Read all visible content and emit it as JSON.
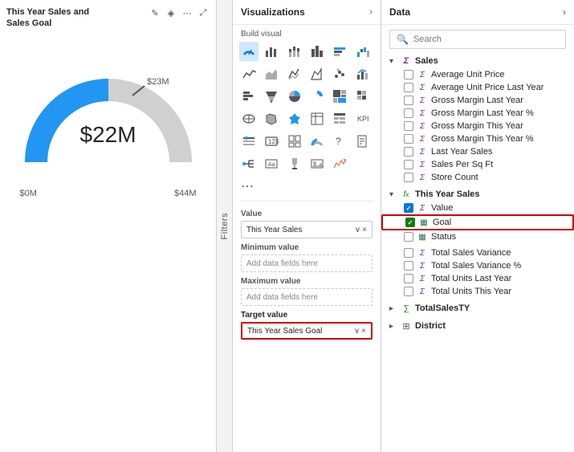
{
  "chart": {
    "title": "This Year Sales and\nSales Goal",
    "center_value": "$22M",
    "target_value": "$23M",
    "min_label": "$0M",
    "max_label": "$44M"
  },
  "filters": {
    "label": "Filters"
  },
  "viz": {
    "title": "Visualizations",
    "build_visual": "Build visual",
    "more_label": "..."
  },
  "fields": {
    "value_label": "Value",
    "value_field": "This Year Sales",
    "min_label": "Minimum value",
    "min_placeholder": "Add data fields here",
    "max_label": "Maximum value",
    "max_placeholder": "Add data fields here",
    "target_label": "Target value",
    "target_field": "This Year Sales Goal"
  },
  "data": {
    "title": "Data",
    "search_placeholder": "Search",
    "groups": [
      {
        "name": "Sales",
        "expanded": true,
        "items": [
          {
            "label": "Average Unit Price",
            "checked": false,
            "icon": "sigma"
          },
          {
            "label": "Average Unit Price Last Year",
            "checked": false,
            "icon": "sigma"
          },
          {
            "label": "Gross Margin Last Year",
            "checked": false,
            "icon": "sigma"
          },
          {
            "label": "Gross Margin Last Year %",
            "checked": false,
            "icon": "sigma"
          },
          {
            "label": "Gross Margin This Year",
            "checked": false,
            "icon": "sigma"
          },
          {
            "label": "Gross Margin This Year %",
            "checked": false,
            "icon": "sigma"
          },
          {
            "label": "Last Year Sales",
            "checked": false,
            "icon": "sigma"
          },
          {
            "label": "Sales Per Sq Ft",
            "checked": false,
            "icon": "sigma"
          },
          {
            "label": "Store Count",
            "checked": false,
            "icon": "sigma"
          }
        ]
      },
      {
        "name": "This Year Sales",
        "expanded": true,
        "items": [
          {
            "label": "Value",
            "checked": true,
            "checkStyle": "blue",
            "icon": "sigma"
          },
          {
            "label": "Goal",
            "checked": true,
            "checkStyle": "green",
            "icon": "table",
            "highlighted": true
          },
          {
            "label": "Status",
            "checked": false,
            "icon": "table"
          }
        ]
      },
      {
        "name": "Total Sales Variance",
        "expanded": false,
        "items": [
          {
            "label": "Total Sales Variance",
            "checked": false,
            "icon": "sigma"
          },
          {
            "label": "Total Sales Variance %",
            "checked": false,
            "icon": "sigma"
          },
          {
            "label": "Total Units Last Year",
            "checked": false,
            "icon": "sigma"
          },
          {
            "label": "Total Units This Year",
            "checked": false,
            "icon": "sigma"
          }
        ]
      },
      {
        "name": "TotalSalesTY",
        "expanded": false,
        "items": []
      },
      {
        "name": "District",
        "expanded": false,
        "items": []
      }
    ]
  }
}
